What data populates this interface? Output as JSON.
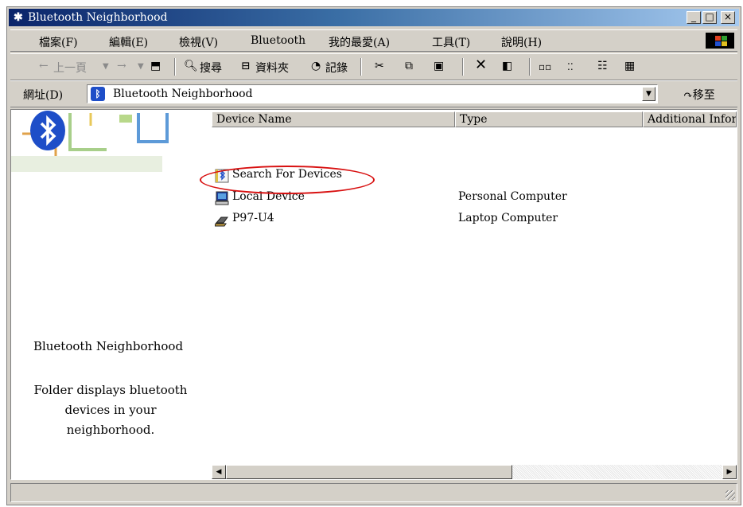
{
  "window": {
    "title": "Bluetooth Neighborhood",
    "title_icon": "bluetooth-icon",
    "min_label": "_",
    "max_label": "□",
    "close_label": "×"
  },
  "menu": {
    "items": [
      "檔案(F)",
      "編輯(E)",
      "檢視(V)",
      "Bluetooth",
      "我的最愛(A)",
      "工具(T)",
      "說明(H)"
    ]
  },
  "toolbar": {
    "back_label": "上一頁",
    "search_label": "搜尋",
    "folders_label": "資料夾",
    "history_label": "記錄"
  },
  "address": {
    "label": "網址(D)",
    "value": "Bluetooth Neighborhood",
    "go_label": "移至"
  },
  "left_panel": {
    "title": "Bluetooth Neighborhood",
    "description": "Folder displays bluetooth devices in your neighborhood."
  },
  "list": {
    "columns": [
      "Device Name",
      "Type",
      "Additional Infor"
    ],
    "rows": [
      {
        "name": "Search For Devices",
        "type": "",
        "icon": "bluetooth-search-icon"
      },
      {
        "name": "Local Device",
        "type": "Personal Computer",
        "icon": "computer-icon"
      },
      {
        "name": "P97-U4",
        "type": "Laptop Computer",
        "icon": "laptop-icon"
      }
    ]
  },
  "colors": {
    "title_gradient_start": "#0a246a",
    "title_gradient_end": "#a6caf0",
    "highlight": "#d81010",
    "bluetooth_blue": "#1e4ec8"
  }
}
